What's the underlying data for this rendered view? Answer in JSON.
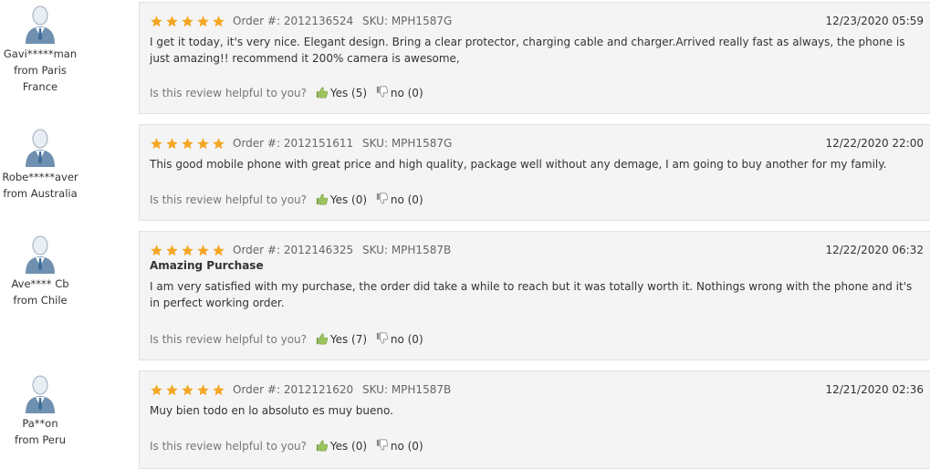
{
  "reviews": [
    {
      "user": "Gavi*****man",
      "from": "from Paris",
      "country": "France",
      "order": "Order #: 2012136524",
      "sku": "SKU: MPH1587G",
      "date": "12/23/2020 05:59",
      "title": "",
      "body": "I get it today, it's very nice. Elegant design. Bring a clear protector, charging cable and charger.Arrived really fast as always, the phone is just amazing!! recommend it 200% camera is awesome,",
      "helpful_question": "Is this review helpful to you?",
      "yes_label": "Yes (5)",
      "no_label": "no (0)",
      "rating": 5
    },
    {
      "user": "Robe*****aver",
      "from": "from Australia",
      "country": "",
      "order": "Order #: 2012151611",
      "sku": "SKU: MPH1587G",
      "date": "12/22/2020 22:00",
      "title": "",
      "body": "This good mobile phone with great price and high quality, package well without any demage, I am going to buy another for my family.",
      "helpful_question": "Is this review helpful to you?",
      "yes_label": "Yes (0)",
      "no_label": "no (0)",
      "rating": 5
    },
    {
      "user": "Ave**** Cb",
      "from": "from Chile",
      "country": "",
      "order": "Order #: 2012146325",
      "sku": "SKU: MPH1587B",
      "date": "12/22/2020 06:32",
      "title": "Amazing Purchase",
      "body": "I am very satisfied with my purchase, the order did take a while to reach but it was totally worth it. Nothings wrong with the phone and it's in perfect working order.",
      "helpful_question": "Is this review helpful to you?",
      "yes_label": "Yes (7)",
      "no_label": "no (0)",
      "rating": 5
    },
    {
      "user": "Pa**on",
      "from": "from Peru",
      "country": "",
      "order": "Order #: 2012121620",
      "sku": "SKU: MPH1587B",
      "date": "12/21/2020 02:36",
      "title": "",
      "body": "Muy bien todo en lo absoluto es muy bueno.",
      "helpful_question": "Is this review helpful to you?",
      "yes_label": "Yes (0)",
      "no_label": "no (0)",
      "rating": 5
    }
  ],
  "colors": {
    "star": "#f5a623",
    "card_bg": "#f4f4f4",
    "border": "#e2e2e2"
  },
  "icons": {
    "avatar": "user-avatar-icon",
    "star": "star-icon",
    "yes": "thumbs-up-icon",
    "no": "thumbs-down-icon"
  }
}
